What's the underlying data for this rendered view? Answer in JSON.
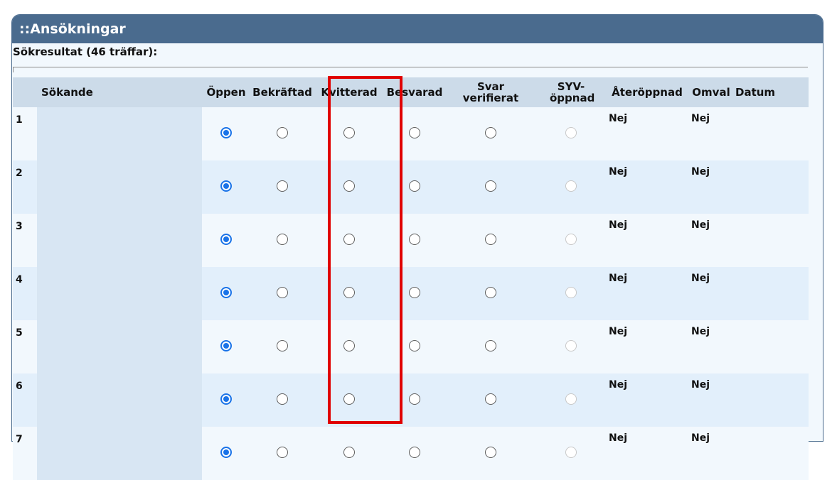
{
  "panel": {
    "title": "::Ansökningar"
  },
  "results": {
    "title": "Sökresultat (46 träffar):"
  },
  "columns": {
    "num": "",
    "name": "Sökande",
    "open": "Öppen",
    "confirmed": "Bekräftad",
    "receipted": "Kvitterad",
    "answered": "Besvarad",
    "answer_verified": "Svar verifierat",
    "syv_opened": "SYV- öppnad",
    "reopened": "Återöppnad",
    "reselected": "Omval",
    "date": "Datum"
  },
  "rows": [
    {
      "num": "1",
      "name": "",
      "selected": "open",
      "reopened": "Nej",
      "reselected": "Nej",
      "date": ""
    },
    {
      "num": "2",
      "name": "",
      "selected": "open",
      "reopened": "Nej",
      "reselected": "Nej",
      "date": ""
    },
    {
      "num": "3",
      "name": "",
      "selected": "open",
      "reopened": "Nej",
      "reselected": "Nej",
      "date": ""
    },
    {
      "num": "4",
      "name": "",
      "selected": "open",
      "reopened": "Nej",
      "reselected": "Nej",
      "date": ""
    },
    {
      "num": "5",
      "name": "",
      "selected": "open",
      "reopened": "Nej",
      "reselected": "Nej",
      "date": ""
    },
    {
      "num": "6",
      "name": "",
      "selected": "open",
      "reopened": "Nej",
      "reselected": "Nej",
      "date": ""
    },
    {
      "num": "7",
      "name": "",
      "selected": "open",
      "reopened": "Nej",
      "reselected": "Nej",
      "date": ""
    }
  ],
  "colors": {
    "header_bg": "#4a6b8e",
    "column_header_bg": "#ccdbe9",
    "radio_checked": "#1a73e8",
    "highlight_box": "#e00000"
  }
}
